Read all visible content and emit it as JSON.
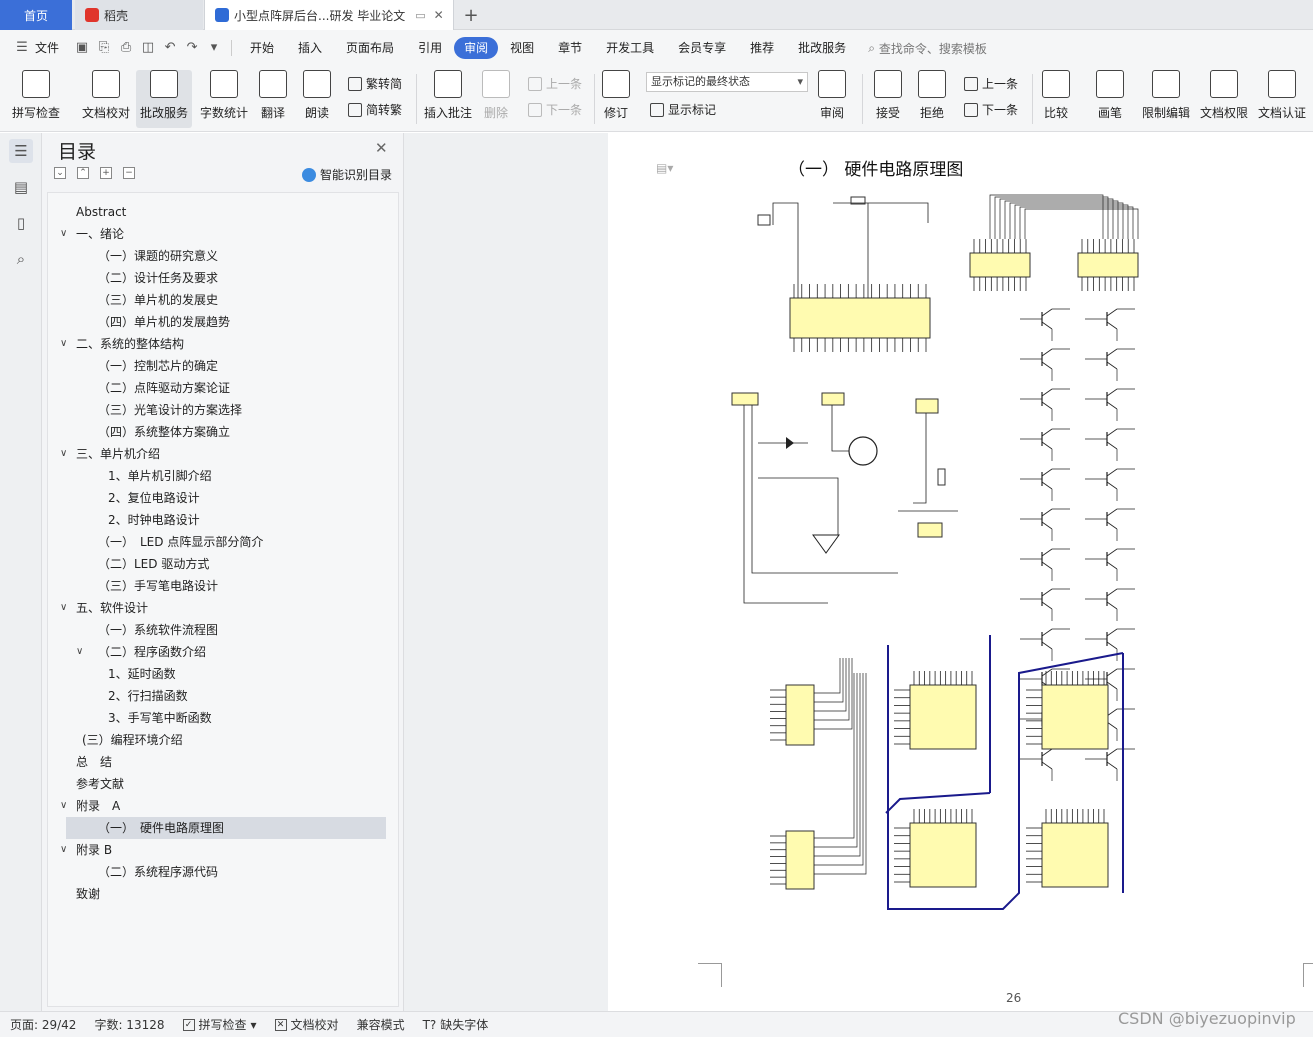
{
  "tabs": {
    "home": "首页",
    "daoke": "稻壳",
    "doc": "小型点阵屏后台...研发 毕业论文",
    "add": "+",
    "close": "✕"
  },
  "menu": {
    "file": "文件",
    "items": [
      "开始",
      "插入",
      "页面布局",
      "引用",
      "审阅",
      "视图",
      "章节",
      "开发工具",
      "会员专享",
      "推荐",
      "批改服务"
    ],
    "active": "审阅",
    "search": "查找命令、搜索模板"
  },
  "ribbon": {
    "spell": "拼写检查",
    "proof": "文档校对",
    "correct": "批改服务",
    "count": "字数统计",
    "translate": "翻译",
    "read": "朗读",
    "trad": "繁转简",
    "simp": "简转繁",
    "insert_comment": "插入批注",
    "delete": "删除",
    "prev": "上一条",
    "next": "下一条",
    "revise": "修订",
    "markup_state": "显示标记的最终状态",
    "show_markup": "显示标记",
    "review": "审阅",
    "accept": "接受",
    "reject": "拒绝",
    "prev2": "上一条",
    "next2": "下一条",
    "compare": "比较",
    "pen": "画笔",
    "restrict": "限制编辑",
    "rights": "文档权限",
    "cert": "文档认证"
  },
  "toc": {
    "title": "目录",
    "smart": "智能识别目录",
    "items": [
      {
        "label": "Abstract",
        "level": 0,
        "caret": ""
      },
      {
        "label": "一、绪论",
        "level": 0,
        "caret": "v"
      },
      {
        "label": "（一）课题的研究意义",
        "level": 1,
        "caret": ""
      },
      {
        "label": "（二）设计任务及要求",
        "level": 1,
        "caret": ""
      },
      {
        "label": "（三）单片机的发展史",
        "level": 1,
        "caret": ""
      },
      {
        "label": "（四）单片机的发展趋势",
        "level": 1,
        "caret": ""
      },
      {
        "label": "二、系统的整体结构",
        "level": 0,
        "caret": "v"
      },
      {
        "label": "（一）控制芯片的确定",
        "level": 1,
        "caret": ""
      },
      {
        "label": "（二）点阵驱动方案论证",
        "level": 1,
        "caret": ""
      },
      {
        "label": "（三）光笔设计的方案选择",
        "level": 1,
        "caret": ""
      },
      {
        "label": "（四）系统整体方案确立",
        "level": 1,
        "caret": ""
      },
      {
        "label": "三、单片机介绍",
        "level": 0,
        "caret": "v"
      },
      {
        "label": "1、单片机引脚介绍",
        "level": 2,
        "caret": ""
      },
      {
        "label": "2、复位电路设计",
        "level": 2,
        "caret": ""
      },
      {
        "label": "2、时钟电路设计",
        "level": 2,
        "caret": ""
      },
      {
        "label": "（一）　LED 点阵显示部分简介",
        "level": 1,
        "caret": ""
      },
      {
        "label": "（二）LED 驱动方式",
        "level": 1,
        "caret": ""
      },
      {
        "label": "（三）手写笔电路设计",
        "level": 1,
        "caret": ""
      },
      {
        "label": "五、软件设计",
        "level": 0,
        "caret": "v"
      },
      {
        "label": "（一）系统软件流程图",
        "level": 1,
        "caret": ""
      },
      {
        "label": "（二）程序函数介绍",
        "level": 1,
        "caret": "v"
      },
      {
        "label": "1、延时函数",
        "level": 2,
        "caret": ""
      },
      {
        "label": "2、行扫描函数",
        "level": 2,
        "caret": ""
      },
      {
        "label": "3、手写笔中断函数",
        "level": 2,
        "caret": ""
      },
      {
        "label": "(三）编程环境介绍",
        "level": 0.5,
        "caret": ""
      },
      {
        "label": "总　结",
        "level": 0,
        "caret": ""
      },
      {
        "label": "参考文献",
        "level": 0,
        "caret": ""
      },
      {
        "label": "附录　A",
        "level": 0,
        "caret": "v"
      },
      {
        "label": "（一）　硬件电路原理图",
        "level": 1,
        "caret": "",
        "selected": true
      },
      {
        "label": "附录 B",
        "level": 0,
        "caret": "v"
      },
      {
        "label": "（二）系统程序源代码",
        "level": 1,
        "caret": ""
      },
      {
        "label": "致谢",
        "level": 0,
        "caret": ""
      }
    ]
  },
  "document": {
    "heading": "（一）  硬件电路原理图",
    "page_number": "26"
  },
  "status": {
    "page": "页面: 29/42",
    "words": "字数: 13128",
    "spell": "拼写检查",
    "proof": "文档校对",
    "compat": "兼容模式",
    "missing_font": "缺失字体"
  },
  "watermark": "CSDN @biyezuopinvip",
  "colors": {
    "accent": "#3b6fd8",
    "chip_fill": "#fffbb0",
    "wire": "#1a1a8c"
  }
}
